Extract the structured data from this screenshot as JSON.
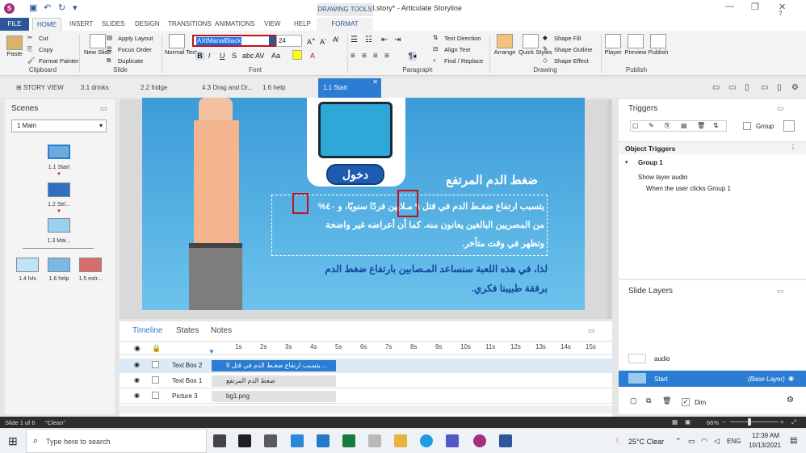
{
  "titlebar": {
    "title": "LAT Final.story* - Articulate Storyline",
    "logo": "S"
  },
  "ribbon_tabs": [
    "FILE",
    "HOME",
    "INSERT",
    "SLIDES",
    "DESIGN",
    "TRANSITIONS",
    "ANIMATIONS",
    "VIEW",
    "HELP"
  ],
  "context_tab": {
    "group": "DRAWING TOOLS",
    "tab": "FORMAT"
  },
  "clipboard": {
    "paste": "Paste",
    "cut": "Cut",
    "copy": "Copy",
    "format_painter": "Format Painter",
    "label": "Clipboard"
  },
  "slide_group": {
    "new_slide": "New Slide",
    "apply_layout": "Apply Layout",
    "focus_order": "Focus Order",
    "duplicate": "Duplicate",
    "label": "Slide"
  },
  "font_group": {
    "normal_text": "Normal Text",
    "font_name": "AXtManalBlack",
    "font_size": "24",
    "label": "Font"
  },
  "paragraph_group": {
    "text_direction": "Text Direction",
    "align_text": "Align Text",
    "find_replace": "Find / Replace",
    "label": "Paragraph"
  },
  "drawing_group": {
    "arrange": "Arrange",
    "quick_styles": "Quick Styles",
    "shape_fill": "Shape Fill",
    "shape_outline": "Shape Outline",
    "shape_effect": "Shape Effect",
    "label": "Drawing"
  },
  "publish_group": {
    "player": "Player",
    "preview": "Preview",
    "publish": "Publish",
    "label": "Publish"
  },
  "view_tabs": [
    "STORY VIEW",
    "3.1 drinks",
    "2.2 fridge",
    "4.3 Drag and Dr...",
    "1.6 help",
    "1.1 Start"
  ],
  "scenes": {
    "title": "Scenes",
    "dropdown": "1 Main",
    "slides": [
      "1.1 Start",
      "1.2 Sel...",
      "1.3 Mai...",
      "1.4 lvls",
      "1.6 help",
      "1.5 extr..."
    ]
  },
  "slide": {
    "button_label": "دخول",
    "heading": "ضغط الدم المرتفع",
    "para1_line1": "يتسبب ارتفاع ضغـط الدم في قتل ٩ مـلايين فردًا سنويًا، و ٤٠%",
    "para1_line2": "من المصريين البالغين يعانون منه. كما أن أعراضه غير واضحة",
    "para1_line3": "وتظهر في وقت متأخر.",
    "para2_line1": "لذا، في هذه اللعبة سنساعد المـصابين بارتفاع ضغط الدم",
    "para2_line2": "برفقة طبيبنا فكري."
  },
  "timeline": {
    "tabs": [
      "Timeline",
      "States",
      "Notes"
    ],
    "ticks": [
      "1s",
      "2s",
      "3s",
      "4s",
      "5s",
      "6s",
      "7s",
      "8s",
      "9s",
      "10s",
      "11s",
      "12s",
      "13s",
      "14s",
      "15s"
    ],
    "rows": [
      {
        "name": "Text Box 2",
        "bar": "يتسبب ارتفاع ضغـط الدم في قتل 9 ..."
      },
      {
        "name": "Text Box 1",
        "bar": "ضغط الدم المرتفع"
      },
      {
        "name": "Picture 3",
        "bar": "bg1.png"
      }
    ]
  },
  "triggers": {
    "title": "Triggers",
    "group_label": "Group",
    "object_triggers": "Object Triggers",
    "group_name": "Group 1",
    "action": "Show layer audio",
    "condition": "When the user clicks Group 1"
  },
  "layers": {
    "title": "Slide Layers",
    "items": [
      {
        "name": "audio"
      },
      {
        "name": "Start",
        "tag": "(Base Layer)"
      }
    ],
    "dim_label": "Dim"
  },
  "status": {
    "slide_info": "Slide 1 of 6",
    "theme": "\"Clean\"",
    "zoom": "66%"
  },
  "taskbar": {
    "search_placeholder": "Type here to search",
    "weather": "25°C  Clear",
    "lang": "ENG",
    "time": "12:39 AM",
    "date": "10/13/2021"
  },
  "colors": {
    "ribbon_blue": "#2b579a",
    "active_tab": "#2b7cd3",
    "highlight_red": "#c0121b",
    "slide_bg": "#4aa8e0"
  }
}
